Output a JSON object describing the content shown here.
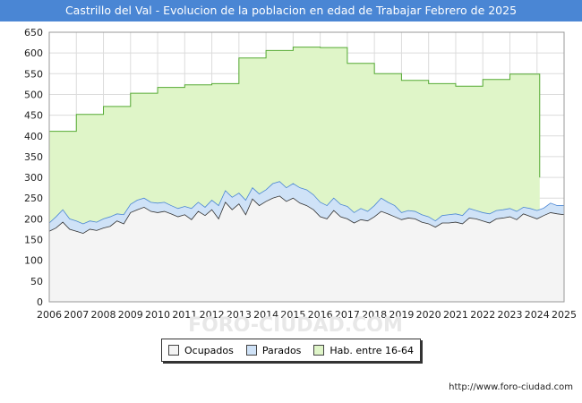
{
  "title": "Castrillo del Val - Evolucion de la poblacion en edad de Trabajar Febrero de 2025",
  "source": "http://www.foro-ciudad.com",
  "watermark": "FORO-CIUDAD.COM",
  "colors": {
    "ocupados_fill": "#f4f4f4",
    "parados_fill": "#cfe2f7",
    "hab_fill": "#dff5c8",
    "hab_line": "#55aa33",
    "ocupados_line": "#333333",
    "parados_line": "#4a86d4"
  },
  "chart_data": {
    "type": "area",
    "ylim": [
      0,
      650
    ],
    "yticks": [
      0,
      50,
      100,
      150,
      200,
      250,
      300,
      350,
      400,
      450,
      500,
      550,
      600,
      650
    ],
    "xticks": [
      "2006",
      "2007",
      "2008",
      "2009",
      "2010",
      "2011",
      "2012",
      "2013",
      "2014",
      "2015",
      "2016",
      "2017",
      "2018",
      "2019",
      "2020",
      "2021",
      "2022",
      "2023",
      "2024",
      "2025"
    ],
    "grid": true,
    "legend_position": "bottom",
    "series": [
      {
        "name": "Hab. entre 16-64",
        "kind": "step",
        "x": [
          2006,
          2007,
          2008,
          2009,
          2010,
          2011,
          2012,
          2013,
          2014,
          2015,
          2016,
          2017,
          2018,
          2019,
          2020,
          2021,
          2022,
          2023,
          2024,
          2024.1
        ],
        "values": [
          411,
          452,
          471,
          503,
          517,
          523,
          526,
          588,
          606,
          614,
          613,
          575,
          550,
          534,
          526,
          520,
          536,
          549,
          549,
          300
        ]
      },
      {
        "name": "Parados",
        "kind": "line",
        "x": [
          2006,
          2006.25,
          2006.5,
          2006.75,
          2007,
          2007.25,
          2007.5,
          2007.75,
          2008,
          2008.25,
          2008.5,
          2008.75,
          2009,
          2009.25,
          2009.5,
          2009.75,
          2010,
          2010.25,
          2010.5,
          2010.75,
          2011,
          2011.25,
          2011.5,
          2011.75,
          2012,
          2012.25,
          2012.5,
          2012.75,
          2013,
          2013.25,
          2013.5,
          2013.75,
          2014,
          2014.25,
          2014.5,
          2014.75,
          2015,
          2015.25,
          2015.5,
          2015.75,
          2016,
          2016.25,
          2016.5,
          2016.75,
          2017,
          2017.25,
          2017.5,
          2017.75,
          2018,
          2018.25,
          2018.5,
          2018.75,
          2019,
          2019.25,
          2019.5,
          2019.75,
          2020,
          2020.25,
          2020.5,
          2020.75,
          2021,
          2021.25,
          2021.5,
          2021.75,
          2022,
          2022.25,
          2022.5,
          2022.75,
          2023,
          2023.25,
          2023.5,
          2023.75,
          2024,
          2024.25,
          2024.5,
          2024.75,
          2025
        ],
        "values": [
          190,
          205,
          222,
          200,
          195,
          188,
          195,
          192,
          200,
          205,
          212,
          210,
          235,
          245,
          250,
          240,
          238,
          240,
          232,
          225,
          230,
          225,
          240,
          228,
          245,
          232,
          268,
          252,
          262,
          245,
          275,
          260,
          270,
          285,
          290,
          275,
          285,
          275,
          270,
          258,
          240,
          232,
          250,
          235,
          230,
          215,
          225,
          218,
          232,
          250,
          240,
          232,
          215,
          220,
          218,
          210,
          205,
          195,
          208,
          210,
          212,
          208,
          225,
          220,
          215,
          212,
          220,
          222,
          225,
          218,
          228,
          225,
          220,
          226,
          238,
          232,
          232
        ]
      },
      {
        "name": "Ocupados",
        "kind": "line",
        "x": [
          2006,
          2006.25,
          2006.5,
          2006.75,
          2007,
          2007.25,
          2007.5,
          2007.75,
          2008,
          2008.25,
          2008.5,
          2008.75,
          2009,
          2009.25,
          2009.5,
          2009.75,
          2010,
          2010.25,
          2010.5,
          2010.75,
          2011,
          2011.25,
          2011.5,
          2011.75,
          2012,
          2012.25,
          2012.5,
          2012.75,
          2013,
          2013.25,
          2013.5,
          2013.75,
          2014,
          2014.25,
          2014.5,
          2014.75,
          2015,
          2015.25,
          2015.5,
          2015.75,
          2016,
          2016.25,
          2016.5,
          2016.75,
          2017,
          2017.25,
          2017.5,
          2017.75,
          2018,
          2018.25,
          2018.5,
          2018.75,
          2019,
          2019.25,
          2019.5,
          2019.75,
          2020,
          2020.25,
          2020.5,
          2020.75,
          2021,
          2021.25,
          2021.5,
          2021.75,
          2022,
          2022.25,
          2022.5,
          2022.75,
          2023,
          2023.25,
          2023.5,
          2023.75,
          2024,
          2024.25,
          2024.5,
          2024.75,
          2025
        ],
        "values": [
          170,
          178,
          192,
          175,
          170,
          165,
          175,
          172,
          178,
          182,
          195,
          188,
          215,
          222,
          228,
          218,
          215,
          218,
          212,
          205,
          210,
          198,
          218,
          208,
          222,
          200,
          240,
          222,
          236,
          210,
          248,
          232,
          242,
          250,
          255,
          242,
          250,
          238,
          232,
          222,
          205,
          200,
          220,
          205,
          200,
          190,
          198,
          195,
          205,
          218,
          212,
          205,
          198,
          202,
          200,
          192,
          188,
          180,
          190,
          190,
          192,
          188,
          202,
          200,
          195,
          190,
          200,
          202,
          205,
          198,
          212,
          206,
          200,
          208,
          215,
          212,
          210
        ]
      }
    ]
  },
  "legend": [
    {
      "label": "Ocupados",
      "color": "#f4f4f4"
    },
    {
      "label": "Parados",
      "color": "#cfe2f7"
    },
    {
      "label": "Hab. entre 16-64",
      "color": "#dff5c8"
    }
  ]
}
